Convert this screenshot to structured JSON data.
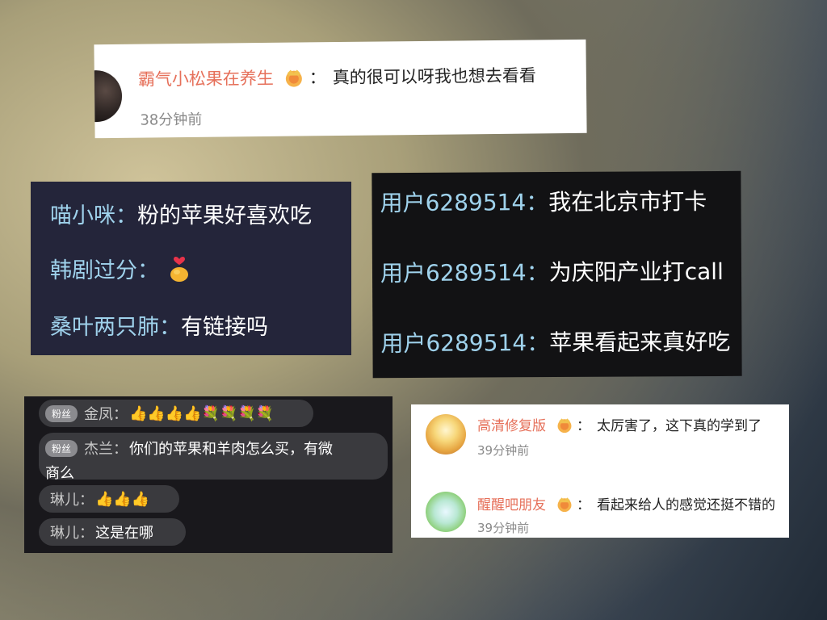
{
  "card_top": {
    "username": "霸气小松果在养生",
    "colon": "：",
    "message": "真的很可以呀我也想去看看",
    "time": "38分钟前",
    "badge_icon": "crown-badge-icon"
  },
  "card_navy": {
    "rows": [
      {
        "name": "喵小咪：",
        "message": "粉的苹果好喜欢吃"
      },
      {
        "name": "韩剧过分：",
        "message": "",
        "emoji": "finger-heart-icon"
      },
      {
        "name": "桑叶两只肺：",
        "message": "有链接吗"
      }
    ]
  },
  "card_black": {
    "rows": [
      {
        "name": "用户6289514：",
        "message": "我在北京市打卡"
      },
      {
        "name": "用户6289514：",
        "message": "为庆阳产业打call"
      },
      {
        "name": "用户6289514：",
        "message": "苹果看起来真好吃"
      }
    ]
  },
  "card_live": {
    "fans_label": "粉丝",
    "rows": [
      {
        "name": "金凤：",
        "emojis": "👍👍👍👍💐💐💐💐"
      },
      {
        "name": "杰兰：",
        "message_line1": "你们的苹果和羊肉怎么买，有微",
        "message_line2": "商么"
      },
      {
        "name": "琳儿：",
        "emojis": "👍👍👍"
      },
      {
        "name": "琳儿：",
        "message": "这是在哪"
      }
    ]
  },
  "card_bottom_right": {
    "comments": [
      {
        "username": "高清修复版",
        "colon": "：",
        "message": "太厉害了，这下真的学到了",
        "time": "39分钟前"
      },
      {
        "username": "醒醒吧朋友",
        "colon": "：",
        "message": "看起来给人的感觉还挺不错的",
        "time": "39分钟前"
      }
    ]
  }
}
